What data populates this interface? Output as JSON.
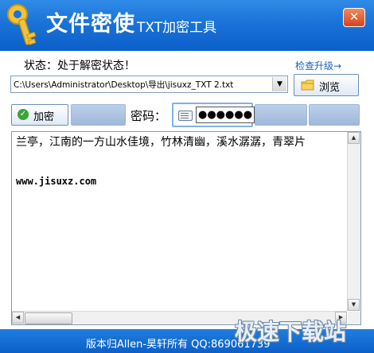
{
  "titlebar": {
    "title": "文件密使",
    "subtitle": "TXT加密工具",
    "close_glyph": "✕"
  },
  "status": {
    "text": "状态：处于解密状态！",
    "upgrade_link": "检查升级→"
  },
  "file": {
    "path": "C:\\Users\\Administrator\\Desktop\\导出\\jisuxz_TXT 2.txt",
    "browse_label": "浏览"
  },
  "actions": {
    "encrypt_label": "加密",
    "password_label": "密码：",
    "password_mask": "●●●●●●"
  },
  "content": {
    "line1": "兰亭，江南的一方山水佳境，竹林清幽，溪水潺潺，青翠片",
    "url": "www.jisuxz.com"
  },
  "footer": {
    "copyright": "版本归Allen-昊轩所有  QQ:869061739"
  },
  "watermark": "极速下载站",
  "colors": {
    "titlebar": "#1a73d8",
    "footer": "#0c5fc6",
    "link": "#1a5fc0",
    "disabled_button": "#a9c0e0"
  },
  "icons": [
    "key-icon",
    "close-icon",
    "dropdown-arrow-icon",
    "folder-icon",
    "check-icon",
    "keyboard-icon"
  ]
}
